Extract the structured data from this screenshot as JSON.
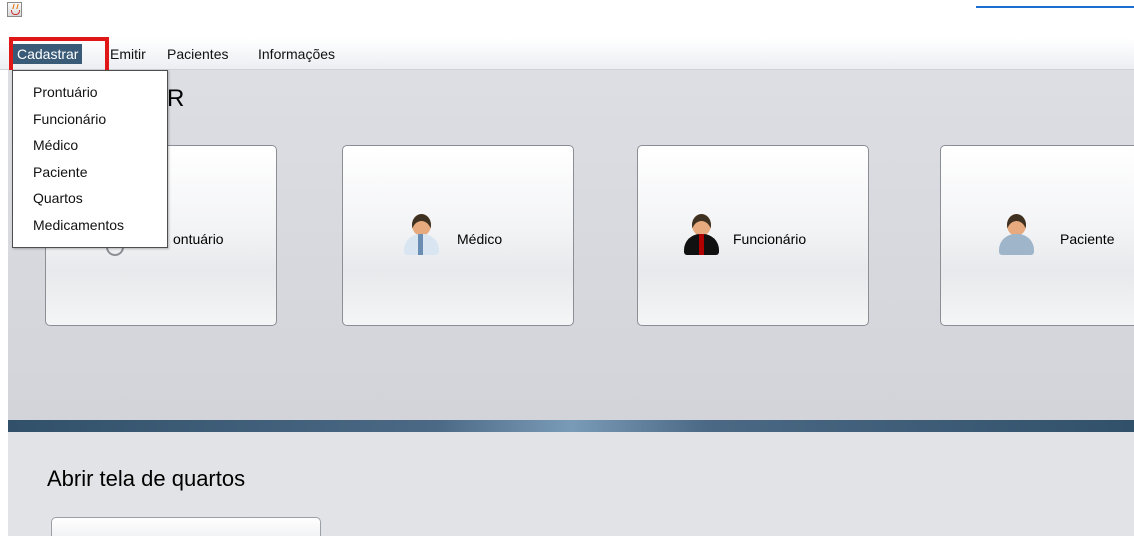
{
  "menubar": {
    "items": [
      "Cadastrar",
      "Emitir",
      "Pacientes",
      "Informações"
    ]
  },
  "dropdown": {
    "items": [
      "Prontuário",
      "Funcionário",
      "Médico",
      "Paciente",
      "Quartos",
      "Medicamentos"
    ]
  },
  "upper_panel": {
    "section_label": "R",
    "buttons": [
      {
        "label": "ontuário",
        "icon": "prontuario-icon"
      },
      {
        "label": "Médico",
        "icon": "doctor-icon"
      },
      {
        "label": "Funcionário",
        "icon": "funcionario-icon"
      },
      {
        "label": "Paciente",
        "icon": "paciente-icon"
      }
    ]
  },
  "lower_panel": {
    "title": "Abrir tela de quartos"
  },
  "colors": {
    "menu_active_bg": "#3a5b78",
    "annotation_red": "#e01717",
    "divider": "#31506a"
  }
}
